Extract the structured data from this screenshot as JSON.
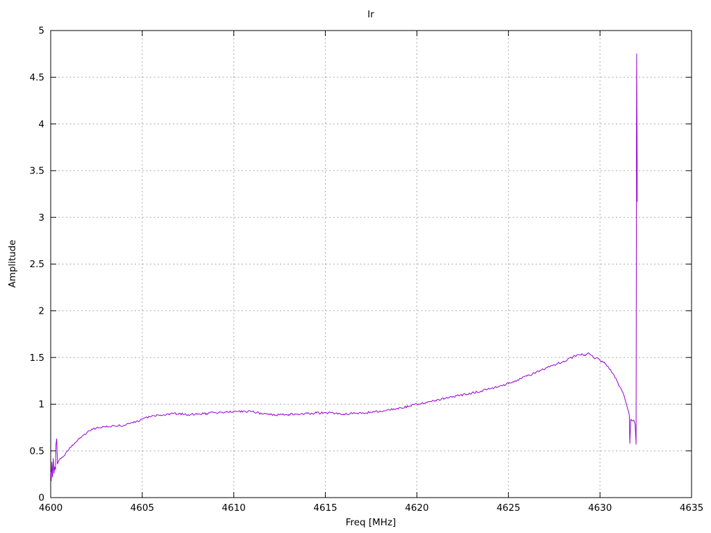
{
  "title": "Ir",
  "axes": {
    "x": {
      "label": "Freq [MHz]",
      "min": 4600,
      "max": 4635,
      "ticks": [
        4600,
        4605,
        4610,
        4615,
        4620,
        4625,
        4630,
        4635
      ],
      "tick_labels": [
        "4600",
        "4605",
        "4610",
        "4615",
        "4620",
        "4625",
        "4630",
        "4635"
      ]
    },
    "y": {
      "label": "Amplitude",
      "min": 0,
      "max": 5,
      "ticks": [
        0,
        0.5,
        1,
        1.5,
        2,
        2.5,
        3,
        3.5,
        4,
        4.5,
        5
      ],
      "tick_labels": [
        "0",
        "0.5",
        "1",
        "1.5",
        "2",
        "2.5",
        "3",
        "3.5",
        "4",
        "4.5",
        "5"
      ]
    }
  },
  "colors": {
    "line": "#9400d3",
    "grid": "#a8a8a8",
    "axis": "#000000",
    "background": "#ffffff"
  },
  "chart_data": {
    "type": "line",
    "title": "Ir",
    "xlabel": "Freq [MHz]",
    "ylabel": "Amplitude",
    "xlim": [
      4600,
      4635
    ],
    "ylim": [
      0,
      5
    ],
    "grid": true,
    "legend": "none",
    "noise_amplitude": 0.012,
    "series": [
      {
        "name": "Ir",
        "color": "#9400d3",
        "points": [
          [
            4600.0,
            0.27
          ],
          [
            4600.03,
            0.18
          ],
          [
            4600.06,
            0.38
          ],
          [
            4600.1,
            0.22
          ],
          [
            4600.14,
            0.42
          ],
          [
            4600.18,
            0.26
          ],
          [
            4600.22,
            0.33
          ],
          [
            4600.26,
            0.3
          ],
          [
            4600.29,
            0.57
          ],
          [
            4600.33,
            0.63
          ],
          [
            4600.37,
            0.36
          ],
          [
            4600.45,
            0.4
          ],
          [
            4600.6,
            0.43
          ],
          [
            4600.8,
            0.47
          ],
          [
            4601.0,
            0.52
          ],
          [
            4601.2,
            0.56
          ],
          [
            4601.4,
            0.6
          ],
          [
            4601.6,
            0.64
          ],
          [
            4601.8,
            0.67
          ],
          [
            4602.0,
            0.7
          ],
          [
            4602.3,
            0.73
          ],
          [
            4602.6,
            0.745
          ],
          [
            4603.0,
            0.755
          ],
          [
            4603.5,
            0.765
          ],
          [
            4604.0,
            0.775
          ],
          [
            4604.5,
            0.8
          ],
          [
            4605.0,
            0.84
          ],
          [
            4605.5,
            0.87
          ],
          [
            4606.0,
            0.885
          ],
          [
            4606.5,
            0.895
          ],
          [
            4607.0,
            0.9
          ],
          [
            4607.5,
            0.89
          ],
          [
            4608.0,
            0.89
          ],
          [
            4608.5,
            0.9
          ],
          [
            4609.0,
            0.91
          ],
          [
            4609.5,
            0.915
          ],
          [
            4610.0,
            0.92
          ],
          [
            4610.5,
            0.925
          ],
          [
            4611.0,
            0.92
          ],
          [
            4611.5,
            0.9
          ],
          [
            4612.0,
            0.89
          ],
          [
            4612.5,
            0.885
          ],
          [
            4613.0,
            0.89
          ],
          [
            4613.5,
            0.895
          ],
          [
            4614.0,
            0.9
          ],
          [
            4614.5,
            0.905
          ],
          [
            4615.0,
            0.91
          ],
          [
            4615.5,
            0.9
          ],
          [
            4616.0,
            0.895
          ],
          [
            4616.5,
            0.9
          ],
          [
            4617.0,
            0.905
          ],
          [
            4617.5,
            0.915
          ],
          [
            4618.0,
            0.925
          ],
          [
            4618.5,
            0.94
          ],
          [
            4619.0,
            0.955
          ],
          [
            4619.5,
            0.975
          ],
          [
            4620.0,
            1.0
          ],
          [
            4620.5,
            1.02
          ],
          [
            4621.0,
            1.04
          ],
          [
            4621.5,
            1.06
          ],
          [
            4622.0,
            1.08
          ],
          [
            4622.5,
            1.1
          ],
          [
            4623.0,
            1.12
          ],
          [
            4623.5,
            1.14
          ],
          [
            4624.0,
            1.165
          ],
          [
            4624.5,
            1.19
          ],
          [
            4625.0,
            1.22
          ],
          [
            4625.5,
            1.26
          ],
          [
            4626.0,
            1.3
          ],
          [
            4626.5,
            1.34
          ],
          [
            4627.0,
            1.38
          ],
          [
            4627.5,
            1.42
          ],
          [
            4628.0,
            1.46
          ],
          [
            4628.5,
            1.5
          ],
          [
            4629.0,
            1.54
          ],
          [
            4629.2,
            1.52
          ],
          [
            4629.35,
            1.55
          ],
          [
            4629.6,
            1.51
          ],
          [
            4630.0,
            1.47
          ],
          [
            4630.25,
            1.44
          ],
          [
            4630.45,
            1.4
          ],
          [
            4630.7,
            1.33
          ],
          [
            4630.9,
            1.26
          ],
          [
            4631.1,
            1.18
          ],
          [
            4631.3,
            1.1
          ],
          [
            4631.45,
            1.0
          ],
          [
            4631.55,
            0.93
          ],
          [
            4631.6,
            0.88
          ],
          [
            4631.63,
            0.58
          ],
          [
            4631.68,
            0.84
          ],
          [
            4631.75,
            0.82
          ],
          [
            4631.85,
            0.83
          ],
          [
            4631.92,
            0.78
          ],
          [
            4631.97,
            0.57
          ],
          [
            4632.0,
            4.75
          ],
          [
            4632.04,
            3.17
          ]
        ]
      }
    ]
  }
}
